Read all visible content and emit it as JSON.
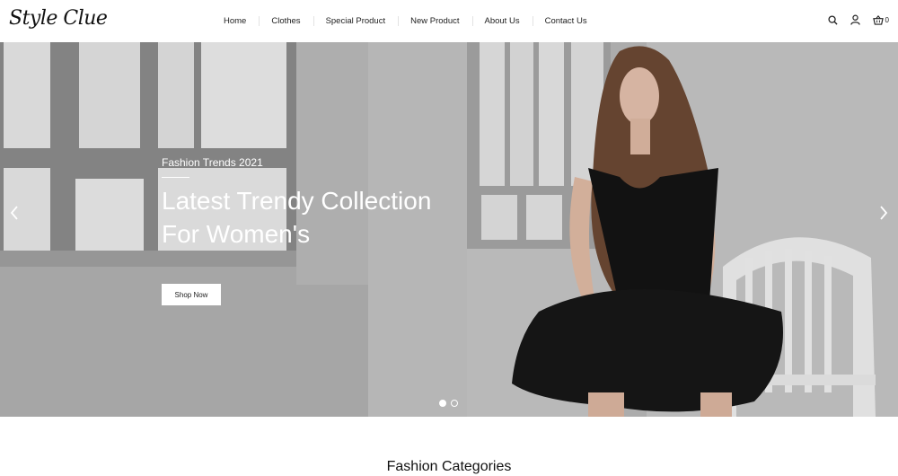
{
  "brand": {
    "logo_text": "Style Clue"
  },
  "nav": {
    "items": [
      {
        "label": "Home"
      },
      {
        "label": "Clothes"
      },
      {
        "label": "Special Product"
      },
      {
        "label": "New Product"
      },
      {
        "label": "About Us"
      },
      {
        "label": "Contact Us"
      }
    ]
  },
  "header_icons": {
    "search": "search-icon",
    "account": "user-icon",
    "cart": "basket-icon",
    "cart_count": "0"
  },
  "hero": {
    "subtitle": "Fashion Trends 2021",
    "title_line1": "Latest Trendy Collection",
    "title_line2": "For Women's",
    "cta_label": "Shop Now",
    "prev_icon": "chevron-left-icon",
    "next_icon": "chevron-right-icon",
    "slides_total": 2,
    "active_slide": 1
  },
  "categories": {
    "heading": "Fashion Categories"
  },
  "colors": {
    "text": "#222222",
    "hero_wall": "#cfcfcf",
    "hero_text": "#ffffff",
    "dress": "#111111"
  }
}
